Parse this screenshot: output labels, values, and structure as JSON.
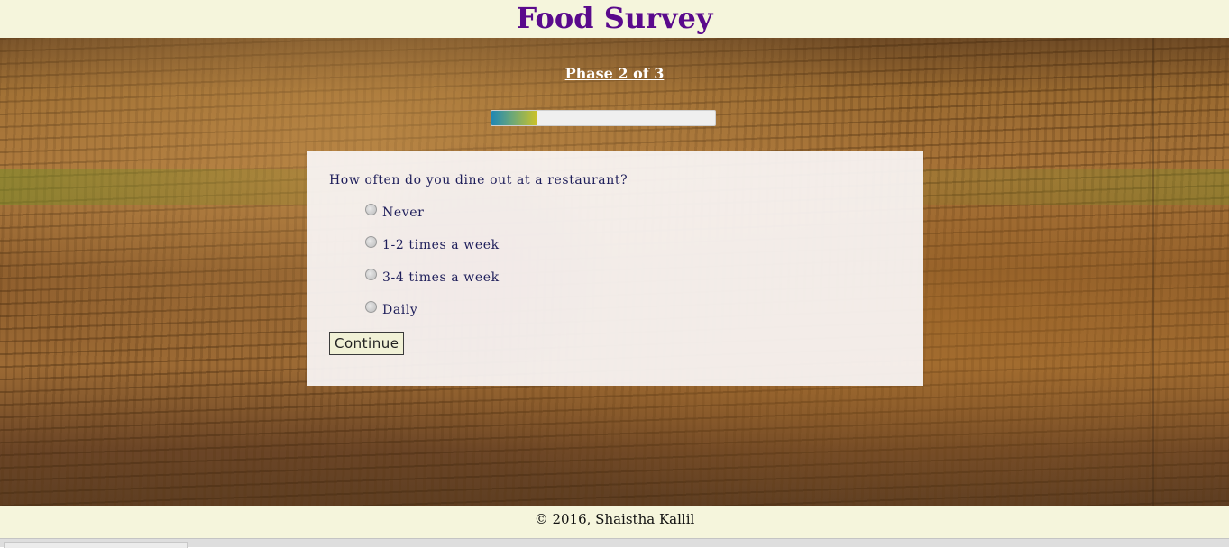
{
  "header": {
    "title": "Food Survey"
  },
  "survey": {
    "phase_label": "Phase 2 of 3",
    "progress": 0.2,
    "question": "How often do you dine out at a restaurant?",
    "options": [
      {
        "label": "Never",
        "selected": false
      },
      {
        "label": "1-2 times a week",
        "selected": false
      },
      {
        "label": "3-4 times a week",
        "selected": false
      },
      {
        "label": "Daily",
        "selected": false
      }
    ],
    "continue_label": "Continue"
  },
  "footer": {
    "text": "© 2016, Shaistha Kallil"
  }
}
